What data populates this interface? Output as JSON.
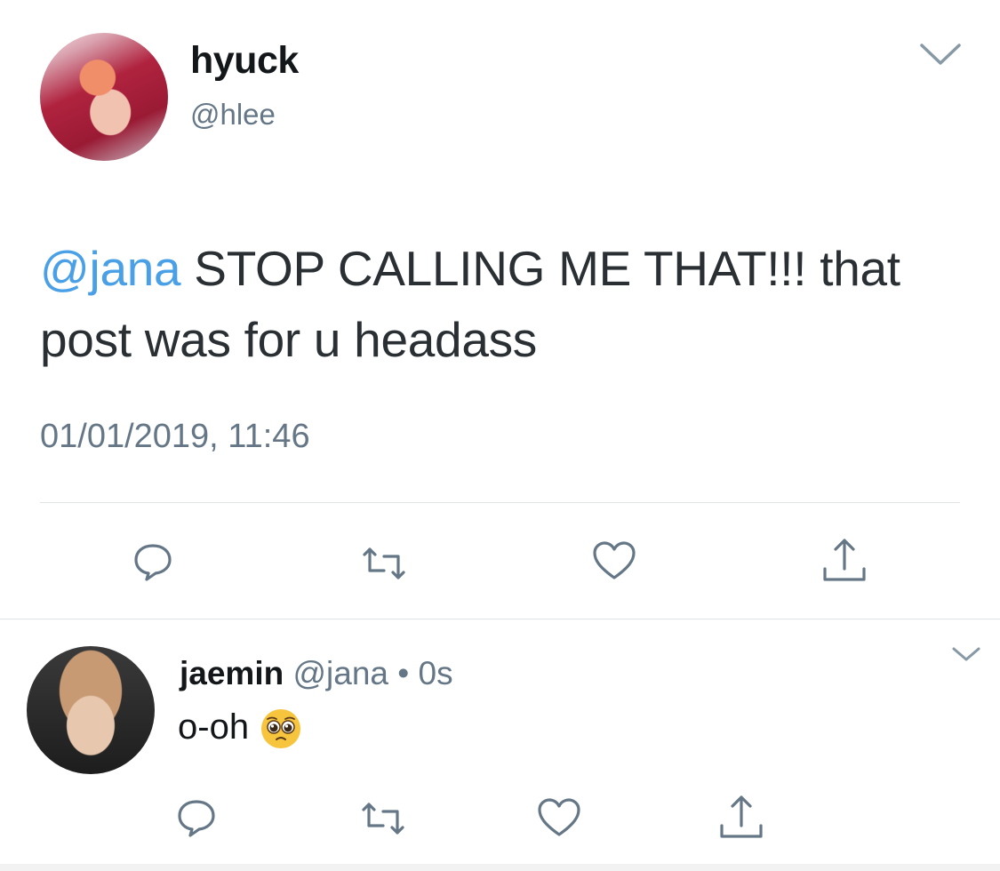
{
  "main_tweet": {
    "display_name": "hyuck",
    "handle": "@hlee",
    "mention": "@jana",
    "text_after_mention": " STOP CALLING ME THAT!!! that post was for u headass",
    "timestamp": "01/01/2019, 11:46",
    "avatar_icon": "user-avatar",
    "menu_icon": "chevron-down-icon",
    "actions": [
      "reply-icon",
      "retweet-icon",
      "like-icon",
      "share-icon"
    ]
  },
  "reply_tweet": {
    "display_name": "jaemin",
    "handle": "@jana",
    "separator": " • ",
    "time_ago": "0s",
    "text": "o-oh",
    "emoji_icon": "pleading-face-emoji",
    "avatar_icon": "user-avatar",
    "menu_icon": "chevron-down-icon",
    "actions": [
      "reply-icon",
      "retweet-icon",
      "like-icon",
      "share-icon"
    ]
  },
  "colors": {
    "mention": "#4aa0e6",
    "secondary_text": "#657786",
    "primary_text": "#14171a",
    "icon_gray": "#657786",
    "divider": "#dfe3e6"
  }
}
